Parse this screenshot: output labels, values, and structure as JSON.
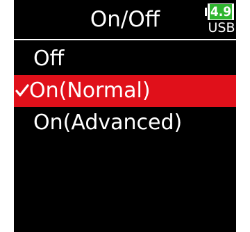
{
  "header": {
    "title": "On/Off",
    "battery_level": "4.9",
    "power_source": "USB",
    "battery_color": "#2fb52f"
  },
  "menu": {
    "items": [
      {
        "label": "Off",
        "selected": false
      },
      {
        "label": "On(Normal)",
        "selected": true
      },
      {
        "label": "On(Advanced)",
        "selected": false
      }
    ]
  },
  "colors": {
    "background": "#000000",
    "highlight": "#e0101a",
    "text": "#ffffff"
  }
}
